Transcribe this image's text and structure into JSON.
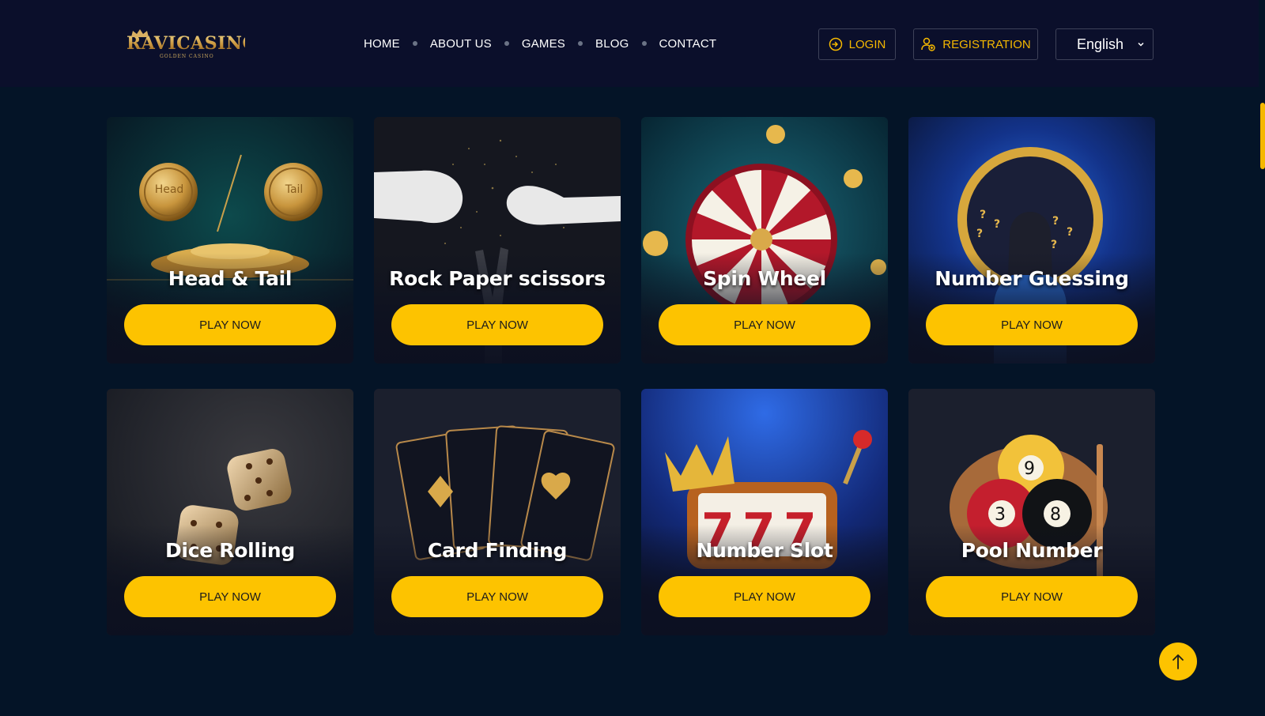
{
  "brand": {
    "name": "RAVICASINO",
    "tagline": "GOLDEN CASINO"
  },
  "nav": {
    "items": [
      {
        "label": "HOME"
      },
      {
        "label": "ABOUT US"
      },
      {
        "label": "GAMES"
      },
      {
        "label": "BLOG"
      },
      {
        "label": "CONTACT"
      }
    ]
  },
  "header": {
    "login_label": "LOGIN",
    "login_icon": "login-icon",
    "registration_label": "REGISTRATION",
    "registration_icon": "user-add-icon",
    "language": "English"
  },
  "games": [
    {
      "title": "Head & Tail",
      "button": "PLAY NOW",
      "coin_left": "Head",
      "coin_right": "Tail"
    },
    {
      "title": "Rock Paper scissors",
      "button": "PLAY NOW"
    },
    {
      "title": "Spin Wheel",
      "button": "PLAY NOW"
    },
    {
      "title": "Number Guessing",
      "button": "PLAY NOW"
    },
    {
      "title": "Dice Rolling",
      "button": "PLAY NOW"
    },
    {
      "title": "Card Finding",
      "button": "PLAY NOW"
    },
    {
      "title": "Number Slot",
      "button": "PLAY NOW"
    },
    {
      "title": "Pool Number",
      "button": "PLAY NOW"
    }
  ],
  "colors": {
    "accent": "#fdc300",
    "header_bg": "#0b0f2b",
    "page_bg": "#041427"
  },
  "scroll_top_icon": "arrow-up-icon"
}
